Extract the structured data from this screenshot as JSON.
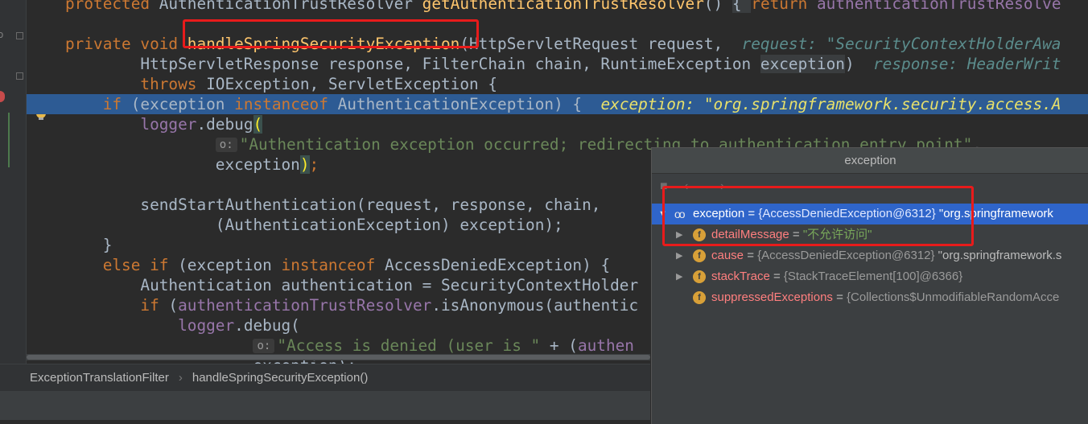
{
  "code_lines": [
    {
      "parts": [
        {
          "t": "protected ",
          "c": "kw"
        },
        {
          "t": "AuthenticationTrustResolver "
        },
        {
          "t": "getAuthenticationTrustResolver",
          "c": "fn"
        },
        {
          "t": "() "
        },
        {
          "t": "{ ",
          "c": "sel"
        },
        {
          "t": "return ",
          "c": "kw"
        },
        {
          "t": "authenticationTrustResolve",
          "c": "fld"
        }
      ]
    },
    {
      "parts": []
    },
    {
      "parts": [
        {
          "t": "private void ",
          "c": "kw"
        },
        {
          "t": "handleSpringSecurityException",
          "c": "fn"
        },
        {
          "t": "(HttpServletRequest request,  "
        },
        {
          "t": "request: \"SecurityContextHolderAwa",
          "c": "hint"
        }
      ]
    },
    {
      "parts": [
        {
          "t": "        HttpServletResponse response, FilterChain chain, RuntimeException "
        },
        {
          "t": "exception",
          "c": "sel"
        },
        {
          "t": ")  "
        },
        {
          "t": "response: HeaderWrit",
          "c": "hint"
        }
      ]
    },
    {
      "parts": [
        {
          "t": "        throws ",
          "c": "kw"
        },
        {
          "t": "IOException, ServletException {"
        }
      ]
    },
    {
      "parts": [
        {
          "t": "    if ",
          "c": "kw"
        },
        {
          "t": "(exception "
        },
        {
          "t": "instanceof ",
          "c": "kw"
        },
        {
          "t": "AuthenticationException) {  "
        },
        {
          "t": "exception: \"org.springframework.security.access.A",
          "c": "hint"
        }
      ]
    },
    {
      "parts": [
        {
          "t": "        logger",
          "c": "fld"
        },
        {
          "t": ".debug"
        },
        {
          "t": "(",
          "c": "brace"
        }
      ]
    },
    {
      "parts": [
        {
          "t": "                "
        },
        {
          "t": "o:",
          "c": "param"
        },
        {
          "t": "\"Authentication exception occurred; redirecting to authentication entry point\"",
          "c": "str"
        },
        {
          "t": ","
        }
      ]
    },
    {
      "parts": [
        {
          "t": "                exception"
        },
        {
          "t": ")",
          "c": "brace"
        },
        {
          "t": ";",
          "c": "kw"
        }
      ]
    },
    {
      "parts": []
    },
    {
      "parts": [
        {
          "t": "        sendStartAuthentication(request, response, chain,"
        }
      ]
    },
    {
      "parts": [
        {
          "t": "                (AuthenticationException) exception);"
        }
      ]
    },
    {
      "parts": [
        {
          "t": "    }"
        }
      ]
    },
    {
      "parts": [
        {
          "t": "    else if ",
          "c": "kw"
        },
        {
          "t": "(exception "
        },
        {
          "t": "instanceof ",
          "c": "kw"
        },
        {
          "t": "AccessDeniedException) {"
        }
      ]
    },
    {
      "parts": [
        {
          "t": "        Authentication authentication = SecurityContextHolder"
        }
      ]
    },
    {
      "parts": [
        {
          "t": "        if ",
          "c": "kw"
        },
        {
          "t": "("
        },
        {
          "t": "authenticationTrustResolver",
          "c": "fld"
        },
        {
          "t": ".isAnonymous(authentic"
        }
      ]
    },
    {
      "parts": [
        {
          "t": "            logger",
          "c": "fld"
        },
        {
          "t": ".debug("
        }
      ]
    },
    {
      "parts": [
        {
          "t": "                    "
        },
        {
          "t": "o:",
          "c": "param"
        },
        {
          "t": "\"Access is denied (user is \"",
          "c": "str"
        },
        {
          "t": " + ("
        },
        {
          "t": "authen",
          "c": "fld"
        }
      ]
    },
    {
      "parts": [
        {
          "t": "                    exception);"
        }
      ]
    }
  ],
  "breadcrumb": {
    "class_name": "ExceptionTranslationFilter",
    "method_name": "handleSpringSecurityException()"
  },
  "debugger": {
    "title": "exception",
    "rows": [
      {
        "name": "exception",
        "eq": " = ",
        "type": "{AccessDeniedException@6312}",
        "value": " \"org.springframework"
      },
      {
        "name": "detailMessage",
        "eq": " = ",
        "type": "",
        "value": "\"不允许访问\""
      },
      {
        "name": "cause",
        "eq": " = ",
        "type": "{AccessDeniedException@6312}",
        "value": " \"org.springframework.s"
      },
      {
        "name": "stackTrace",
        "eq": " = ",
        "type": "{StackTraceElement[100]@6366}",
        "value": ""
      },
      {
        "name": "suppressedExceptions",
        "eq": " = ",
        "type": "{Collections$UnmodifiableRandomAcce",
        "value": ""
      }
    ]
  },
  "colors": {
    "highlight_line": "#2d5b94",
    "selection_row": "#2f65ca",
    "annotation_box": "#e81b1b",
    "field_icon": "#d8a038"
  }
}
